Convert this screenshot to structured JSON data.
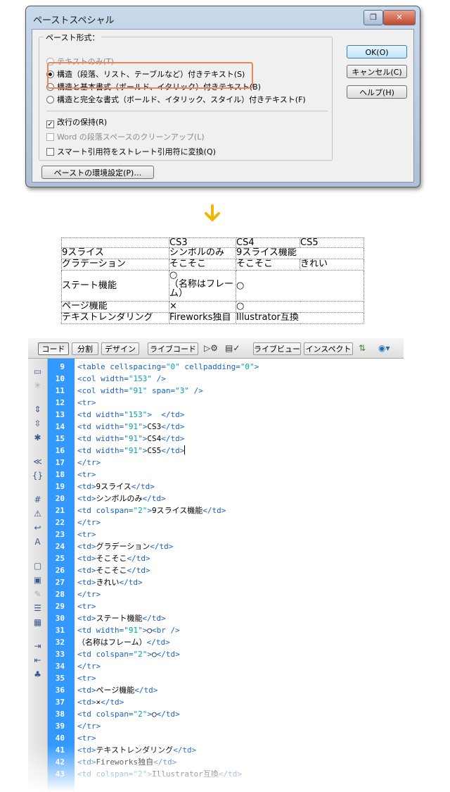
{
  "dialog": {
    "title": "ペーストスペシャル",
    "group_label": "ペースト形式：",
    "options": [
      {
        "label": "テキストのみ(T)",
        "selected": false,
        "disabled": true
      },
      {
        "label": "構造（段落、リスト、テーブルなど）付きテキスト(S)",
        "selected": true,
        "disabled": false
      },
      {
        "label": "構造と基本書式（ボールド、イタリック）付きテキスト(B)",
        "selected": false,
        "disabled": false
      },
      {
        "label": "構造と完全な書式（ボールド、イタリック、スタイル）付きテキスト(F)",
        "selected": false,
        "disabled": false
      }
    ],
    "checks": [
      {
        "label": "改行の保持(R)",
        "checked": true,
        "disabled": false
      },
      {
        "label": "Word の段落スペースのクリーンアップ(L)",
        "checked": false,
        "disabled": true
      },
      {
        "label": "スマート引用符をストレート引用符に変換(Q)",
        "checked": false,
        "disabled": false
      }
    ],
    "prefs_button": "ペーストの環境設定(P)…",
    "ok_button": "OK(O)",
    "cancel_button": "キャンセル(C)",
    "help_button": "ヘルプ(H)",
    "highlight_color": "#e8875c"
  },
  "arrow_color": "#f5b400",
  "preview": {
    "header": [
      "",
      "CS3",
      "CS4",
      "CS5"
    ],
    "row1": [
      "9スライス",
      "シンボルのみ",
      "9スライス機能"
    ],
    "row2": [
      "グラデーション",
      "そこそこ",
      "そこそこ",
      "きれい"
    ],
    "row3": [
      "ステート機能",
      "○",
      "（名称はフレーム）",
      "○"
    ],
    "row4": [
      "ページ機能",
      "×",
      "○"
    ],
    "row5": [
      "テキストレンダリング",
      "Fireworks独自",
      "Illustrator互換"
    ]
  },
  "editor": {
    "toolbar": {
      "code": "コード",
      "split": "分割",
      "design": "デザイン",
      "live_code": "ライブコード",
      "live_view": "ライブビュー",
      "inspect": "インスペクト"
    },
    "gutter_color": "#3399ff",
    "lines": [
      {
        "n": "9",
        "parts": [
          [
            "tag",
            "<table "
          ],
          [
            "attr",
            "cellspacing="
          ],
          [
            "val",
            "\"0\""
          ],
          [
            "attr",
            " cellpadding="
          ],
          [
            "val",
            "\"0\""
          ],
          [
            "tag",
            ">"
          ]
        ]
      },
      {
        "n": "10",
        "parts": [
          [
            "tag",
            "<col "
          ],
          [
            "attr",
            "width="
          ],
          [
            "val",
            "\"153\""
          ],
          [
            "tag",
            " />"
          ]
        ]
      },
      {
        "n": "11",
        "parts": [
          [
            "tag",
            "<col "
          ],
          [
            "attr",
            "width="
          ],
          [
            "val",
            "\"91\""
          ],
          [
            "attr",
            " span="
          ],
          [
            "val",
            "\"3\""
          ],
          [
            "tag",
            " />"
          ]
        ]
      },
      {
        "n": "12",
        "parts": [
          [
            "tag",
            "<tr>"
          ]
        ]
      },
      {
        "n": "13",
        "parts": [
          [
            "tag",
            "<td "
          ],
          [
            "attr",
            "width="
          ],
          [
            "val",
            "\"153\""
          ],
          [
            "tag",
            ">  </td>"
          ]
        ]
      },
      {
        "n": "14",
        "parts": [
          [
            "tag",
            "<td "
          ],
          [
            "attr",
            "width="
          ],
          [
            "val",
            "\"91\""
          ],
          [
            "tag",
            ">"
          ],
          [
            "txt",
            "CS3"
          ],
          [
            "tag",
            "</td>"
          ]
        ]
      },
      {
        "n": "15",
        "parts": [
          [
            "tag",
            "<td "
          ],
          [
            "attr",
            "width="
          ],
          [
            "val",
            "\"91\""
          ],
          [
            "tag",
            ">"
          ],
          [
            "txt",
            "CS4"
          ],
          [
            "tag",
            "</td>"
          ]
        ]
      },
      {
        "n": "16",
        "parts": [
          [
            "tag",
            "<td "
          ],
          [
            "attr",
            "width="
          ],
          [
            "val",
            "\"91\""
          ],
          [
            "tag",
            ">"
          ],
          [
            "txt",
            "CS5"
          ],
          [
            "tag",
            "</td>"
          ]
        ],
        "cursor": true
      },
      {
        "n": "17",
        "parts": [
          [
            "tag",
            "</tr>"
          ]
        ]
      },
      {
        "n": "18",
        "parts": [
          [
            "tag",
            "<tr>"
          ]
        ]
      },
      {
        "n": "19",
        "parts": [
          [
            "tag",
            "<td>"
          ],
          [
            "txt",
            "9スライス"
          ],
          [
            "tag",
            "</td>"
          ]
        ]
      },
      {
        "n": "20",
        "parts": [
          [
            "tag",
            "<td>"
          ],
          [
            "txt",
            "シンボルのみ"
          ],
          [
            "tag",
            "</td>"
          ]
        ]
      },
      {
        "n": "21",
        "parts": [
          [
            "tag",
            "<td "
          ],
          [
            "attr",
            "colspan="
          ],
          [
            "val",
            "\"2\""
          ],
          [
            "tag",
            ">"
          ],
          [
            "txt",
            "9スライス機能"
          ],
          [
            "tag",
            "</td>"
          ]
        ]
      },
      {
        "n": "22",
        "parts": [
          [
            "tag",
            "</tr>"
          ]
        ]
      },
      {
        "n": "23",
        "parts": [
          [
            "tag",
            "<tr>"
          ]
        ]
      },
      {
        "n": "24",
        "parts": [
          [
            "tag",
            "<td>"
          ],
          [
            "txt",
            "グラデーション"
          ],
          [
            "tag",
            "</td>"
          ]
        ]
      },
      {
        "n": "25",
        "parts": [
          [
            "tag",
            "<td>"
          ],
          [
            "txt",
            "そこそこ"
          ],
          [
            "tag",
            "</td>"
          ]
        ]
      },
      {
        "n": "26",
        "parts": [
          [
            "tag",
            "<td>"
          ],
          [
            "txt",
            "そこそこ"
          ],
          [
            "tag",
            "</td>"
          ]
        ]
      },
      {
        "n": "27",
        "parts": [
          [
            "tag",
            "<td>"
          ],
          [
            "txt",
            "きれい"
          ],
          [
            "tag",
            "</td>"
          ]
        ]
      },
      {
        "n": "28",
        "parts": [
          [
            "tag",
            "</tr>"
          ]
        ]
      },
      {
        "n": "29",
        "parts": [
          [
            "tag",
            "<tr>"
          ]
        ]
      },
      {
        "n": "30",
        "parts": [
          [
            "tag",
            "<td>"
          ],
          [
            "txt",
            "ステート機能"
          ],
          [
            "tag",
            "</td>"
          ]
        ]
      },
      {
        "n": "31",
        "parts": [
          [
            "tag",
            "<td "
          ],
          [
            "attr",
            "width="
          ],
          [
            "val",
            "\"91\""
          ],
          [
            "tag",
            ">"
          ],
          [
            "txt",
            "○"
          ],
          [
            "tag",
            "<br />"
          ]
        ]
      },
      {
        "n": "32",
        "parts": [
          [
            "txt",
            "（名称はフレーム）"
          ],
          [
            "tag",
            "</td>"
          ]
        ]
      },
      {
        "n": "33",
        "parts": [
          [
            "tag",
            "<td "
          ],
          [
            "attr",
            "colspan="
          ],
          [
            "val",
            "\"2\""
          ],
          [
            "tag",
            ">"
          ],
          [
            "txt",
            "○"
          ],
          [
            "tag",
            "</td>"
          ]
        ]
      },
      {
        "n": "34",
        "parts": [
          [
            "tag",
            "</tr>"
          ]
        ]
      },
      {
        "n": "35",
        "parts": [
          [
            "tag",
            "<tr>"
          ]
        ]
      },
      {
        "n": "36",
        "parts": [
          [
            "tag",
            "<td>"
          ],
          [
            "txt",
            "ページ機能"
          ],
          [
            "tag",
            "</td>"
          ]
        ]
      },
      {
        "n": "37",
        "parts": [
          [
            "tag",
            "<td>"
          ],
          [
            "txt",
            "×"
          ],
          [
            "tag",
            "</td>"
          ]
        ]
      },
      {
        "n": "38",
        "parts": [
          [
            "tag",
            "<td "
          ],
          [
            "attr",
            "colspan="
          ],
          [
            "val",
            "\"2\""
          ],
          [
            "tag",
            ">"
          ],
          [
            "txt",
            "○"
          ],
          [
            "tag",
            "</td>"
          ]
        ]
      },
      {
        "n": "39",
        "parts": [
          [
            "tag",
            "</tr>"
          ]
        ]
      },
      {
        "n": "40",
        "parts": [
          [
            "tag",
            "<tr>"
          ]
        ]
      },
      {
        "n": "41",
        "parts": [
          [
            "tag",
            "<td>"
          ],
          [
            "txt",
            "テキストレンダリング"
          ],
          [
            "tag",
            "</td>"
          ]
        ]
      },
      {
        "n": "42",
        "parts": [
          [
            "tag",
            "<td>"
          ],
          [
            "txt",
            "Fireworks独自"
          ],
          [
            "tag",
            "</td>"
          ]
        ]
      },
      {
        "n": "43",
        "parts": [
          [
            "tag",
            "<td "
          ],
          [
            "attr",
            "colspan="
          ],
          [
            "val",
            "\"2\""
          ],
          [
            "tag",
            ">"
          ],
          [
            "txt",
            "Illustrator互換"
          ],
          [
            "tag",
            "</td>"
          ]
        ]
      }
    ]
  }
}
